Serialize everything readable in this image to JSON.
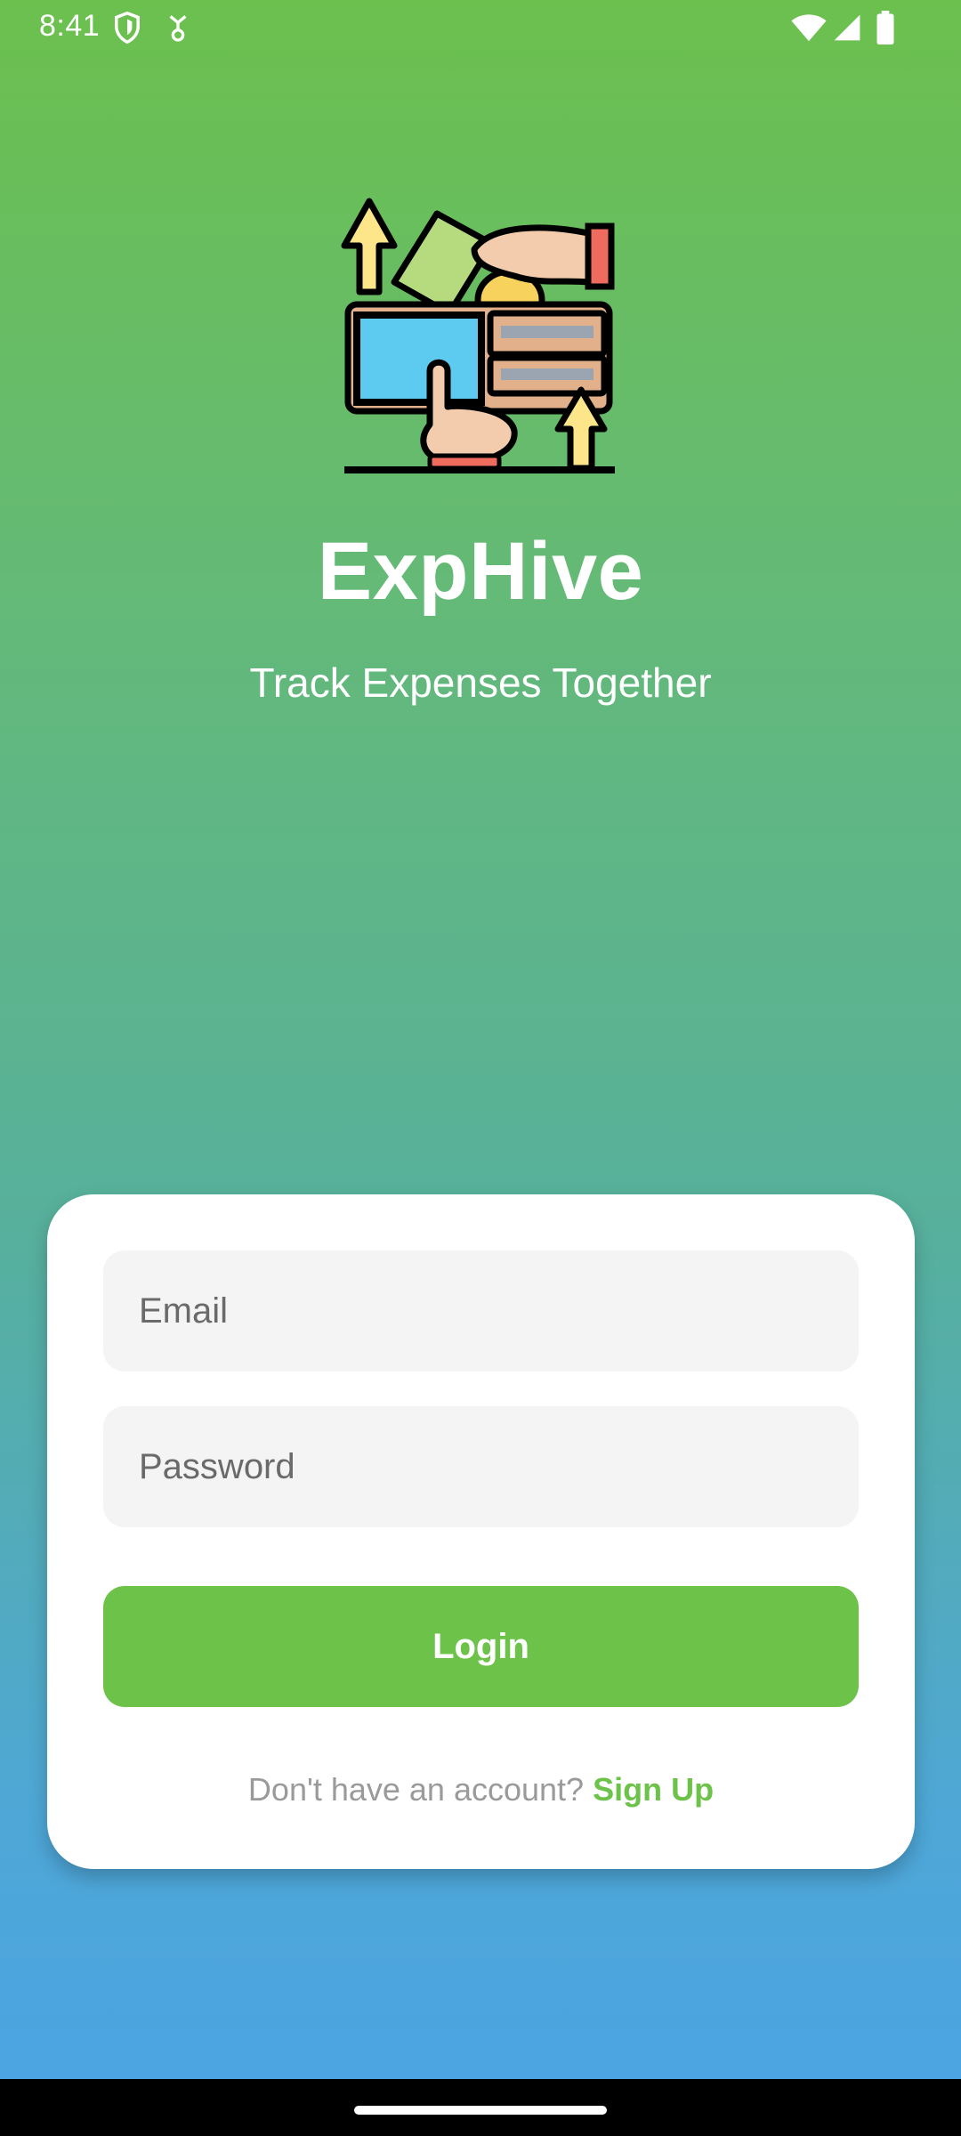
{
  "status_bar": {
    "time": "8:41",
    "icons": [
      "shield-icon",
      "usb-debug-icon",
      "wifi-icon",
      "signal-icon",
      "battery-icon"
    ]
  },
  "hero": {
    "logo_icon": "wallet-money-illustration",
    "title": "ExpHive",
    "tagline": "Track Expenses Together"
  },
  "login_form": {
    "email_placeholder": "Email",
    "password_placeholder": "Password",
    "login_label": "Login",
    "signup_prompt": "Don't have an account?",
    "signup_link": "Sign Up"
  },
  "colors": {
    "gradient_top": "#6cc04e",
    "gradient_bottom": "#4ba3e4",
    "accent": "#6dc249",
    "card": "#ffffff",
    "input_bg": "#f4f4f4"
  }
}
